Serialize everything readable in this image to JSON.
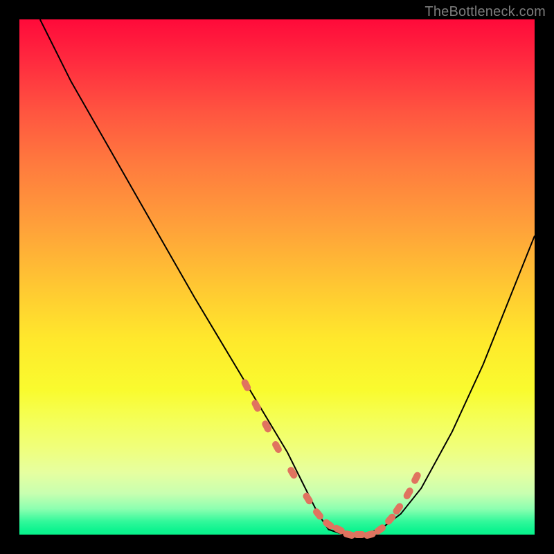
{
  "watermark": {
    "text": "TheBottleneck.com"
  },
  "colors": {
    "frame": "#000000",
    "curve": "#000000",
    "dots": "#e0735f",
    "gradient_stops": [
      "#ff0a3a",
      "#ff5540",
      "#ffa03a",
      "#ffe82c",
      "#f0ff7a",
      "#8cffb0",
      "#10f490"
    ]
  },
  "chart_data": {
    "type": "line",
    "title": "",
    "xlabel": "",
    "ylabel": "",
    "xlim": [
      0,
      100
    ],
    "ylim": [
      0,
      100
    ],
    "grid": false,
    "legend": false,
    "annotations": [
      "TheBottleneck.com"
    ],
    "series": [
      {
        "name": "bottleneck-curve",
        "x": [
          4,
          10,
          18,
          26,
          34,
          40,
          46,
          52,
          56,
          58,
          60,
          63,
          66,
          70,
          74,
          78,
          84,
          90,
          96,
          100
        ],
        "values": [
          100,
          88,
          74,
          60,
          46,
          36,
          26,
          16,
          8,
          4,
          1,
          0,
          0,
          1,
          4,
          9,
          20,
          33,
          48,
          58
        ]
      }
    ],
    "highlighted_points": {
      "name": "highlighted-dash-segment",
      "x": [
        44,
        46,
        48,
        50,
        53,
        56,
        58,
        60,
        62,
        64,
        66,
        68,
        70,
        72,
        73.5,
        75.5,
        77
      ],
      "values": [
        29,
        25,
        21,
        17,
        12,
        7,
        4,
        2,
        1,
        0,
        0,
        0,
        1,
        3,
        5,
        8,
        11
      ]
    }
  }
}
